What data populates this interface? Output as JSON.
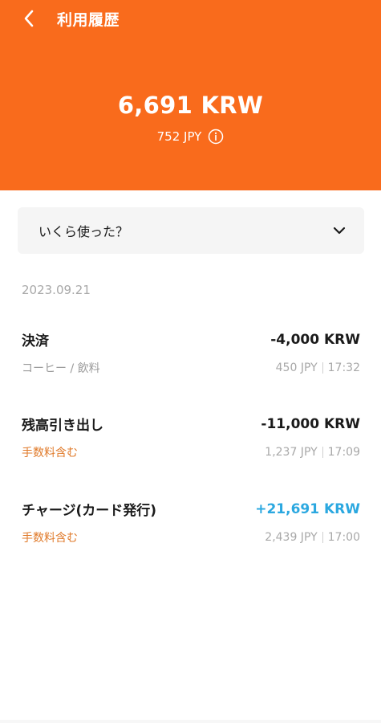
{
  "header": {
    "title": "利用履歴",
    "balance": "6,691 KRW",
    "sub_balance": "752 JPY",
    "background_color": "#f96b1c",
    "back_icon": "chevron-left-icon",
    "info_icon": "info-circle-icon"
  },
  "dropdown": {
    "label": "いくら使った？",
    "icon": "chevron-down-icon"
  },
  "date": "2023.09.21",
  "transactions": [
    {
      "name": "決済",
      "amount": "-4,000 KRW",
      "note": "コーヒー / 飲料",
      "jpy": "450 JPY",
      "time": "17:32"
    },
    {
      "name": "残高引き出し",
      "amount": "-11,000 KRW",
      "note": "手数料含む",
      "jpy": "1,237 JPY",
      "time": "17:09"
    },
    {
      "name": "チャージ(カード発行)",
      "amount": "+21,691 KRW",
      "note": "手数料含む",
      "jpy": "2,439 JPY",
      "time": "17:00"
    }
  ],
  "colors": {
    "accent": "#f96b1c",
    "positive_amount": "#2ba8e0",
    "fee_note": "#e07a2a"
  }
}
